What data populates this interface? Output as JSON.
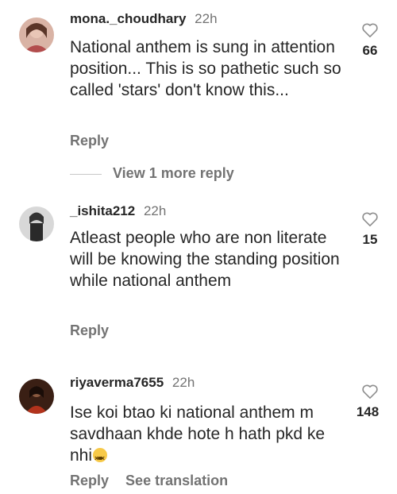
{
  "comments": [
    {
      "username": "mona._choudhary",
      "time": "22h",
      "text": "National anthem is sung in attention position... This is so pathetic such so called 'stars' don't know this...",
      "likes": "66",
      "reply_label": "Reply"
    },
    {
      "username": "_ishita212",
      "time": "22h",
      "text": "Atleast people who are non literate will be knowing the standing position while national anthem",
      "likes": "15",
      "reply_label": "Reply"
    },
    {
      "username": "riyaverma7655",
      "time": "22h",
      "text": "Ise koi btao ki national anthem m savdhaan khde hote h hath pkd ke nhi",
      "emoji": "dizzy-face-emoji",
      "likes": "148",
      "reply_label": "Reply",
      "translate_label": "See translation"
    }
  ],
  "view_more_replies": "View 1 more reply",
  "colors": {
    "text": "#262626",
    "muted": "#737373",
    "divider": "#c7c7c7"
  },
  "icons": {
    "like": "heart-outline-icon"
  }
}
